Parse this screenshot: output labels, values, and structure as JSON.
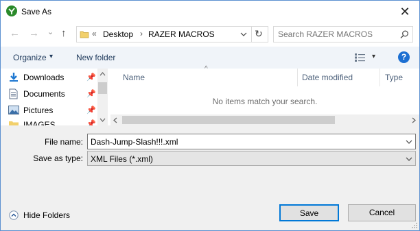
{
  "window": {
    "title": "Save As",
    "close_glyph": "✕"
  },
  "nav": {
    "back_glyph": "←",
    "forward_glyph": "→",
    "recent_glyph": "⌄",
    "up_glyph": "↑",
    "breadcrumb": {
      "overflow": "«",
      "items": [
        "Desktop",
        "RAZER MACROS"
      ],
      "separator": "›"
    },
    "refresh_glyph": "↻",
    "search": {
      "placeholder": "Search RAZER MACROS"
    }
  },
  "toolbar": {
    "organize_label": "Organize",
    "organize_arrow": "▾",
    "new_folder_label": "New folder",
    "view_arrow": "▾",
    "help_glyph": "?"
  },
  "sidebar": {
    "items": [
      {
        "label": "Downloads",
        "icon": "download-icon",
        "pinned": true
      },
      {
        "label": "Documents",
        "icon": "document-icon",
        "pinned": true
      },
      {
        "label": "Pictures",
        "icon": "pictures-icon",
        "pinned": true
      },
      {
        "label": "IMAGES",
        "icon": "folder-icon",
        "pinned": true
      }
    ],
    "pin_glyph": "📌"
  },
  "list": {
    "columns": [
      "Name",
      "Date modified",
      "Type"
    ],
    "sort_glyph": "^",
    "empty_text": "No items match your search."
  },
  "form": {
    "filename_label": "File name:",
    "filename_value": "Dash-Jump-Slash!!!.xml",
    "type_label": "Save as type:",
    "type_value": "XML Files (*.xml)"
  },
  "footer": {
    "hide_folders_label": "Hide Folders",
    "save_label": "Save",
    "cancel_label": "Cancel"
  },
  "colors": {
    "accent": "#0078d7",
    "toolbar_bg": "#f0f4f9",
    "lower_bg": "#f0f0f0",
    "help": "#1c6fd2"
  }
}
